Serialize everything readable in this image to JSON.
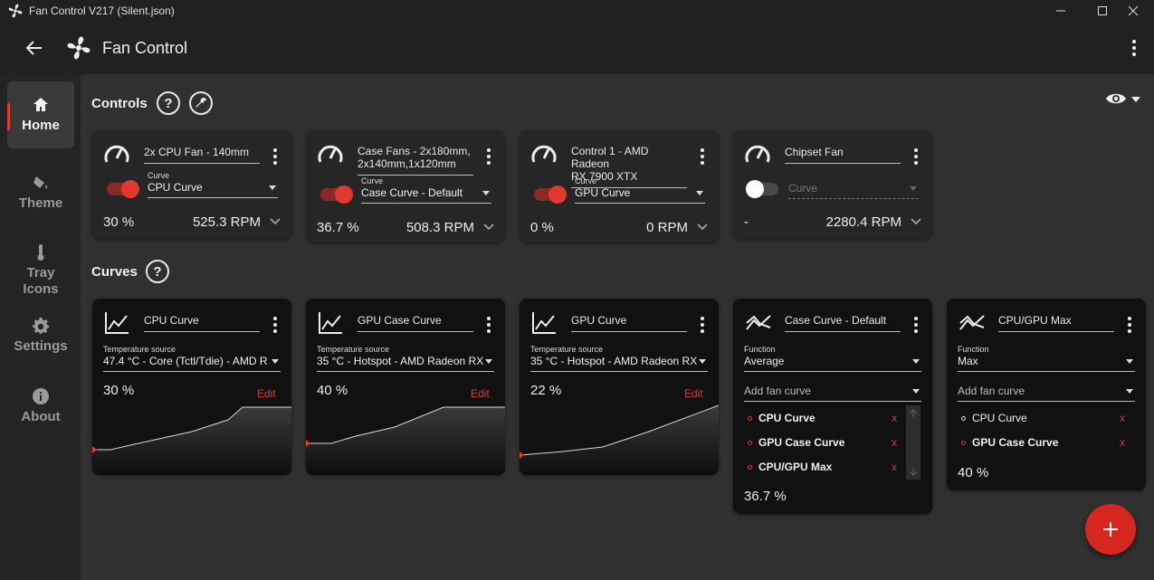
{
  "window": {
    "title": "Fan Control V217 (Silent.json)"
  },
  "header": {
    "title": "Fan Control"
  },
  "sidebar": {
    "items": [
      {
        "label": "Home",
        "icon": "home-icon"
      },
      {
        "label": "Theme",
        "icon": "paint-bucket-icon"
      },
      {
        "label": "Tray Icons",
        "icon": "thermometer-icon"
      },
      {
        "label": "Settings",
        "icon": "gear-icon"
      },
      {
        "label": "About",
        "icon": "info-icon"
      }
    ]
  },
  "sections": {
    "controls": "Controls",
    "curves": "Curves",
    "help": "?"
  },
  "colors": {
    "accent": "#e2392f",
    "background": "#303030",
    "card": "#262626",
    "curve_card": "#111111"
  },
  "controls": [
    {
      "name": "2x CPU Fan - 140mm",
      "curve_label": "Curve",
      "curve": "CPU Curve",
      "enabled": true,
      "percent": "30 %",
      "rpm": "525.3 RPM"
    },
    {
      "name_line1": "Case Fans - 2x180mm,",
      "name_line2": "2x140mm,1x120mm",
      "curve_label": "Curve",
      "curve": "Case Curve - Default",
      "enabled": true,
      "percent": "36.7 %",
      "rpm": "508.3 RPM"
    },
    {
      "name_line1": "Control 1 - AMD Radeon",
      "name_line2": "RX 7900 XTX",
      "curve_label": "Curve",
      "curve": "GPU Curve",
      "enabled": true,
      "percent": "0 %",
      "rpm": "0 RPM"
    },
    {
      "name": "Chipset Fan",
      "curve_placeholder": "Curve",
      "enabled": false,
      "percent": "-",
      "rpm": "2280.4 RPM"
    }
  ],
  "curves": [
    {
      "name": "CPU Curve",
      "source_label": "Temperature source",
      "source": "47.4 °C - Core (Tctl/Tdie) - AMD R",
      "percent": "30 %",
      "edit": "Edit"
    },
    {
      "name": "GPU Case Curve",
      "source_label": "Temperature source",
      "source": "35 °C - Hotspot - AMD Radeon RX",
      "percent": "40 %",
      "edit": "Edit"
    },
    {
      "name": "GPU Curve",
      "source_label": "Temperature source",
      "source": "35 °C - Hotspot - AMD Radeon RX",
      "percent": "22 %",
      "edit": "Edit"
    },
    {
      "name": "Case Curve - Default",
      "function_label": "Function",
      "function": "Average",
      "add_placeholder": "Add fan curve",
      "items": [
        "CPU Curve",
        "GPU Case Curve",
        "CPU/GPU Max"
      ],
      "remove": "x",
      "percent": "36.7 %"
    },
    {
      "name": "CPU/GPU Max",
      "function_label": "Function",
      "function": "Max",
      "add_placeholder": "Add fan curve",
      "items": [
        "CPU Curve",
        "GPU Case Curve"
      ],
      "remove": "x",
      "percent": "40 %"
    }
  ]
}
